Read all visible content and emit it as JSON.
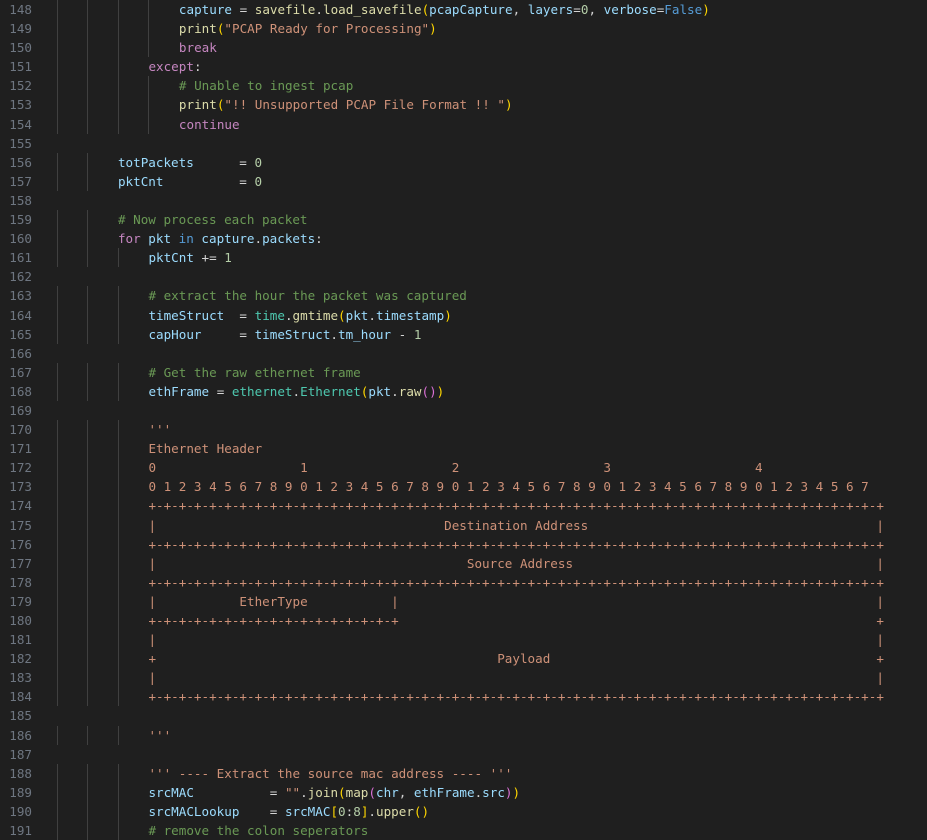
{
  "editor": {
    "language": "python",
    "colors": {
      "background": "#1f1f1f",
      "line_number": "#6e7681",
      "keyword": "#c586c0",
      "function": "#dcdcaa",
      "variable": "#9cdcfe",
      "string": "#ce9178",
      "number": "#b5cea8",
      "comment": "#6a9955"
    },
    "lines": [
      {
        "n": "148",
        "indent": 16,
        "tokens": [
          [
            "var",
            "capture"
          ],
          [
            "op",
            " = "
          ],
          [
            "fn",
            "savefile"
          ],
          [
            "op",
            "."
          ],
          [
            "fn",
            "load_savefile"
          ],
          [
            "br1",
            "("
          ],
          [
            "var",
            "pcapCapture"
          ],
          [
            "op",
            ", "
          ],
          [
            "var",
            "layers"
          ],
          [
            "op",
            "="
          ],
          [
            "num",
            "0"
          ],
          [
            "op",
            ", "
          ],
          [
            "var",
            "verbose"
          ],
          [
            "op",
            "="
          ],
          [
            "kw2",
            "False"
          ],
          [
            "br1",
            ")"
          ]
        ]
      },
      {
        "n": "149",
        "indent": 16,
        "tokens": [
          [
            "fn",
            "print"
          ],
          [
            "br1",
            "("
          ],
          [
            "str",
            "\"PCAP Ready for Processing\""
          ],
          [
            "br1",
            ")"
          ]
        ]
      },
      {
        "n": "150",
        "indent": 16,
        "tokens": [
          [
            "kw",
            "break"
          ]
        ]
      },
      {
        "n": "151",
        "indent": 12,
        "tokens": [
          [
            "kw",
            "except"
          ],
          [
            "op",
            ":"
          ]
        ]
      },
      {
        "n": "152",
        "indent": 16,
        "tokens": [
          [
            "cm",
            "# Unable to ingest pcap"
          ]
        ]
      },
      {
        "n": "153",
        "indent": 16,
        "tokens": [
          [
            "fn",
            "print"
          ],
          [
            "br1",
            "("
          ],
          [
            "str",
            "\"!! Unsupported PCAP File Format !! \""
          ],
          [
            "br1",
            ")"
          ]
        ]
      },
      {
        "n": "154",
        "indent": 16,
        "tokens": [
          [
            "kw",
            "continue"
          ]
        ]
      },
      {
        "n": "155",
        "indent": 0,
        "tokens": []
      },
      {
        "n": "156",
        "indent": 8,
        "tokens": [
          [
            "var",
            "totPackets"
          ],
          [
            "op",
            "      = "
          ],
          [
            "num",
            "0"
          ]
        ]
      },
      {
        "n": "157",
        "indent": 8,
        "tokens": [
          [
            "var",
            "pktCnt"
          ],
          [
            "op",
            "          = "
          ],
          [
            "num",
            "0"
          ]
        ]
      },
      {
        "n": "158",
        "indent": 0,
        "tokens": []
      },
      {
        "n": "159",
        "indent": 8,
        "tokens": [
          [
            "cm",
            "# Now process each packet"
          ]
        ]
      },
      {
        "n": "160",
        "indent": 8,
        "tokens": [
          [
            "kw",
            "for"
          ],
          [
            "op",
            " "
          ],
          [
            "var",
            "pkt"
          ],
          [
            "op",
            " "
          ],
          [
            "kw2",
            "in"
          ],
          [
            "op",
            " "
          ],
          [
            "var",
            "capture"
          ],
          [
            "op",
            "."
          ],
          [
            "var",
            "packets"
          ],
          [
            "op",
            ":"
          ]
        ]
      },
      {
        "n": "161",
        "indent": 12,
        "tokens": [
          [
            "var",
            "pktCnt"
          ],
          [
            "op",
            " += "
          ],
          [
            "num",
            "1"
          ]
        ]
      },
      {
        "n": "162",
        "indent": 0,
        "tokens": []
      },
      {
        "n": "163",
        "indent": 12,
        "tokens": [
          [
            "cm",
            "# extract the hour the packet was captured"
          ]
        ]
      },
      {
        "n": "164",
        "indent": 12,
        "tokens": [
          [
            "var",
            "timeStruct"
          ],
          [
            "op",
            "  = "
          ],
          [
            "cls",
            "time"
          ],
          [
            "op",
            "."
          ],
          [
            "fn",
            "gmtime"
          ],
          [
            "br1",
            "("
          ],
          [
            "var",
            "pkt"
          ],
          [
            "op",
            "."
          ],
          [
            "var",
            "timestamp"
          ],
          [
            "br1",
            ")"
          ]
        ]
      },
      {
        "n": "165",
        "indent": 12,
        "tokens": [
          [
            "var",
            "capHour"
          ],
          [
            "op",
            "     = "
          ],
          [
            "var",
            "timeStruct"
          ],
          [
            "op",
            "."
          ],
          [
            "var",
            "tm_hour"
          ],
          [
            "op",
            " - "
          ],
          [
            "num",
            "1"
          ]
        ]
      },
      {
        "n": "166",
        "indent": 0,
        "tokens": []
      },
      {
        "n": "167",
        "indent": 12,
        "tokens": [
          [
            "cm",
            "# Get the raw ethernet frame"
          ]
        ]
      },
      {
        "n": "168",
        "indent": 12,
        "tokens": [
          [
            "var",
            "ethFrame"
          ],
          [
            "op",
            " = "
          ],
          [
            "cls",
            "ethernet"
          ],
          [
            "op",
            "."
          ],
          [
            "cls",
            "Ethernet"
          ],
          [
            "br1",
            "("
          ],
          [
            "var",
            "pkt"
          ],
          [
            "op",
            "."
          ],
          [
            "fn",
            "raw"
          ],
          [
            "br2",
            "()"
          ],
          [
            "br1",
            ")"
          ]
        ]
      },
      {
        "n": "169",
        "indent": 0,
        "tokens": []
      },
      {
        "n": "170",
        "indent": 12,
        "tokens": [
          [
            "str",
            "'''"
          ]
        ]
      },
      {
        "n": "171",
        "indent": 12,
        "tokens": [
          [
            "str",
            "Ethernet Header"
          ]
        ]
      },
      {
        "n": "172",
        "indent": 12,
        "tokens": [
          [
            "str",
            "0                   1                   2                   3                   4"
          ]
        ]
      },
      {
        "n": "173",
        "indent": 12,
        "tokens": [
          [
            "str",
            "0 1 2 3 4 5 6 7 8 9 0 1 2 3 4 5 6 7 8 9 0 1 2 3 4 5 6 7 8 9 0 1 2 3 4 5 6 7 8 9 0 1 2 3 4 5 6 7"
          ]
        ]
      },
      {
        "n": "174",
        "indent": 12,
        "tokens": [
          [
            "str",
            "+-+-+-+-+-+-+-+-+-+-+-+-+-+-+-+-+-+-+-+-+-+-+-+-+-+-+-+-+-+-+-+-+-+-+-+-+-+-+-+-+-+-+-+-+-+-+-+-+"
          ]
        ]
      },
      {
        "n": "175",
        "indent": 12,
        "tokens": [
          [
            "str",
            "|                                      Destination Address                                      |"
          ]
        ]
      },
      {
        "n": "176",
        "indent": 12,
        "tokens": [
          [
            "str",
            "+-+-+-+-+-+-+-+-+-+-+-+-+-+-+-+-+-+-+-+-+-+-+-+-+-+-+-+-+-+-+-+-+-+-+-+-+-+-+-+-+-+-+-+-+-+-+-+-+"
          ]
        ]
      },
      {
        "n": "177",
        "indent": 12,
        "tokens": [
          [
            "str",
            "|                                         Source Address                                        |"
          ]
        ]
      },
      {
        "n": "178",
        "indent": 12,
        "tokens": [
          [
            "str",
            "+-+-+-+-+-+-+-+-+-+-+-+-+-+-+-+-+-+-+-+-+-+-+-+-+-+-+-+-+-+-+-+-+-+-+-+-+-+-+-+-+-+-+-+-+-+-+-+-+"
          ]
        ]
      },
      {
        "n": "179",
        "indent": 12,
        "tokens": [
          [
            "str",
            "|           EtherType           |                                                               |"
          ]
        ]
      },
      {
        "n": "180",
        "indent": 12,
        "tokens": [
          [
            "str",
            "+-+-+-+-+-+-+-+-+-+-+-+-+-+-+-+-+                                                               +"
          ]
        ]
      },
      {
        "n": "181",
        "indent": 12,
        "tokens": [
          [
            "str",
            "|                                                                                               |"
          ]
        ]
      },
      {
        "n": "182",
        "indent": 12,
        "tokens": [
          [
            "str",
            "+                                             Payload                                           +"
          ]
        ]
      },
      {
        "n": "183",
        "indent": 12,
        "tokens": [
          [
            "str",
            "|                                                                                               |"
          ]
        ]
      },
      {
        "n": "184",
        "indent": 12,
        "tokens": [
          [
            "str",
            "+-+-+-+-+-+-+-+-+-+-+-+-+-+-+-+-+-+-+-+-+-+-+-+-+-+-+-+-+-+-+-+-+-+-+-+-+-+-+-+-+-+-+-+-+-+-+-+-+"
          ]
        ]
      },
      {
        "n": "185",
        "indent": 0,
        "tokens": []
      },
      {
        "n": "186",
        "indent": 12,
        "tokens": [
          [
            "str",
            "'''"
          ]
        ]
      },
      {
        "n": "187",
        "indent": 0,
        "tokens": []
      },
      {
        "n": "188",
        "indent": 12,
        "tokens": [
          [
            "str",
            "''' ---- Extract the source mac address ---- '''"
          ]
        ]
      },
      {
        "n": "189",
        "indent": 12,
        "tokens": [
          [
            "var",
            "srcMAC"
          ],
          [
            "op",
            "          = "
          ],
          [
            "str",
            "\"\""
          ],
          [
            "op",
            "."
          ],
          [
            "fn",
            "join"
          ],
          [
            "br1",
            "("
          ],
          [
            "fn",
            "map"
          ],
          [
            "br2",
            "("
          ],
          [
            "var",
            "chr"
          ],
          [
            "op",
            ", "
          ],
          [
            "var",
            "ethFrame"
          ],
          [
            "op",
            "."
          ],
          [
            "var",
            "src"
          ],
          [
            "br2",
            ")"
          ],
          [
            "br1",
            ")"
          ]
        ]
      },
      {
        "n": "190",
        "indent": 12,
        "tokens": [
          [
            "var",
            "srcMACLookup"
          ],
          [
            "op",
            "    = "
          ],
          [
            "var",
            "srcMAC"
          ],
          [
            "br1",
            "["
          ],
          [
            "num",
            "0"
          ],
          [
            "op",
            ":"
          ],
          [
            "num",
            "8"
          ],
          [
            "br1",
            "]"
          ],
          [
            "op",
            "."
          ],
          [
            "fn",
            "upper"
          ],
          [
            "br1",
            "()"
          ]
        ]
      },
      {
        "n": "191",
        "indent": 12,
        "tokens": [
          [
            "cm",
            "# remove the colon seperators"
          ]
        ]
      }
    ]
  }
}
